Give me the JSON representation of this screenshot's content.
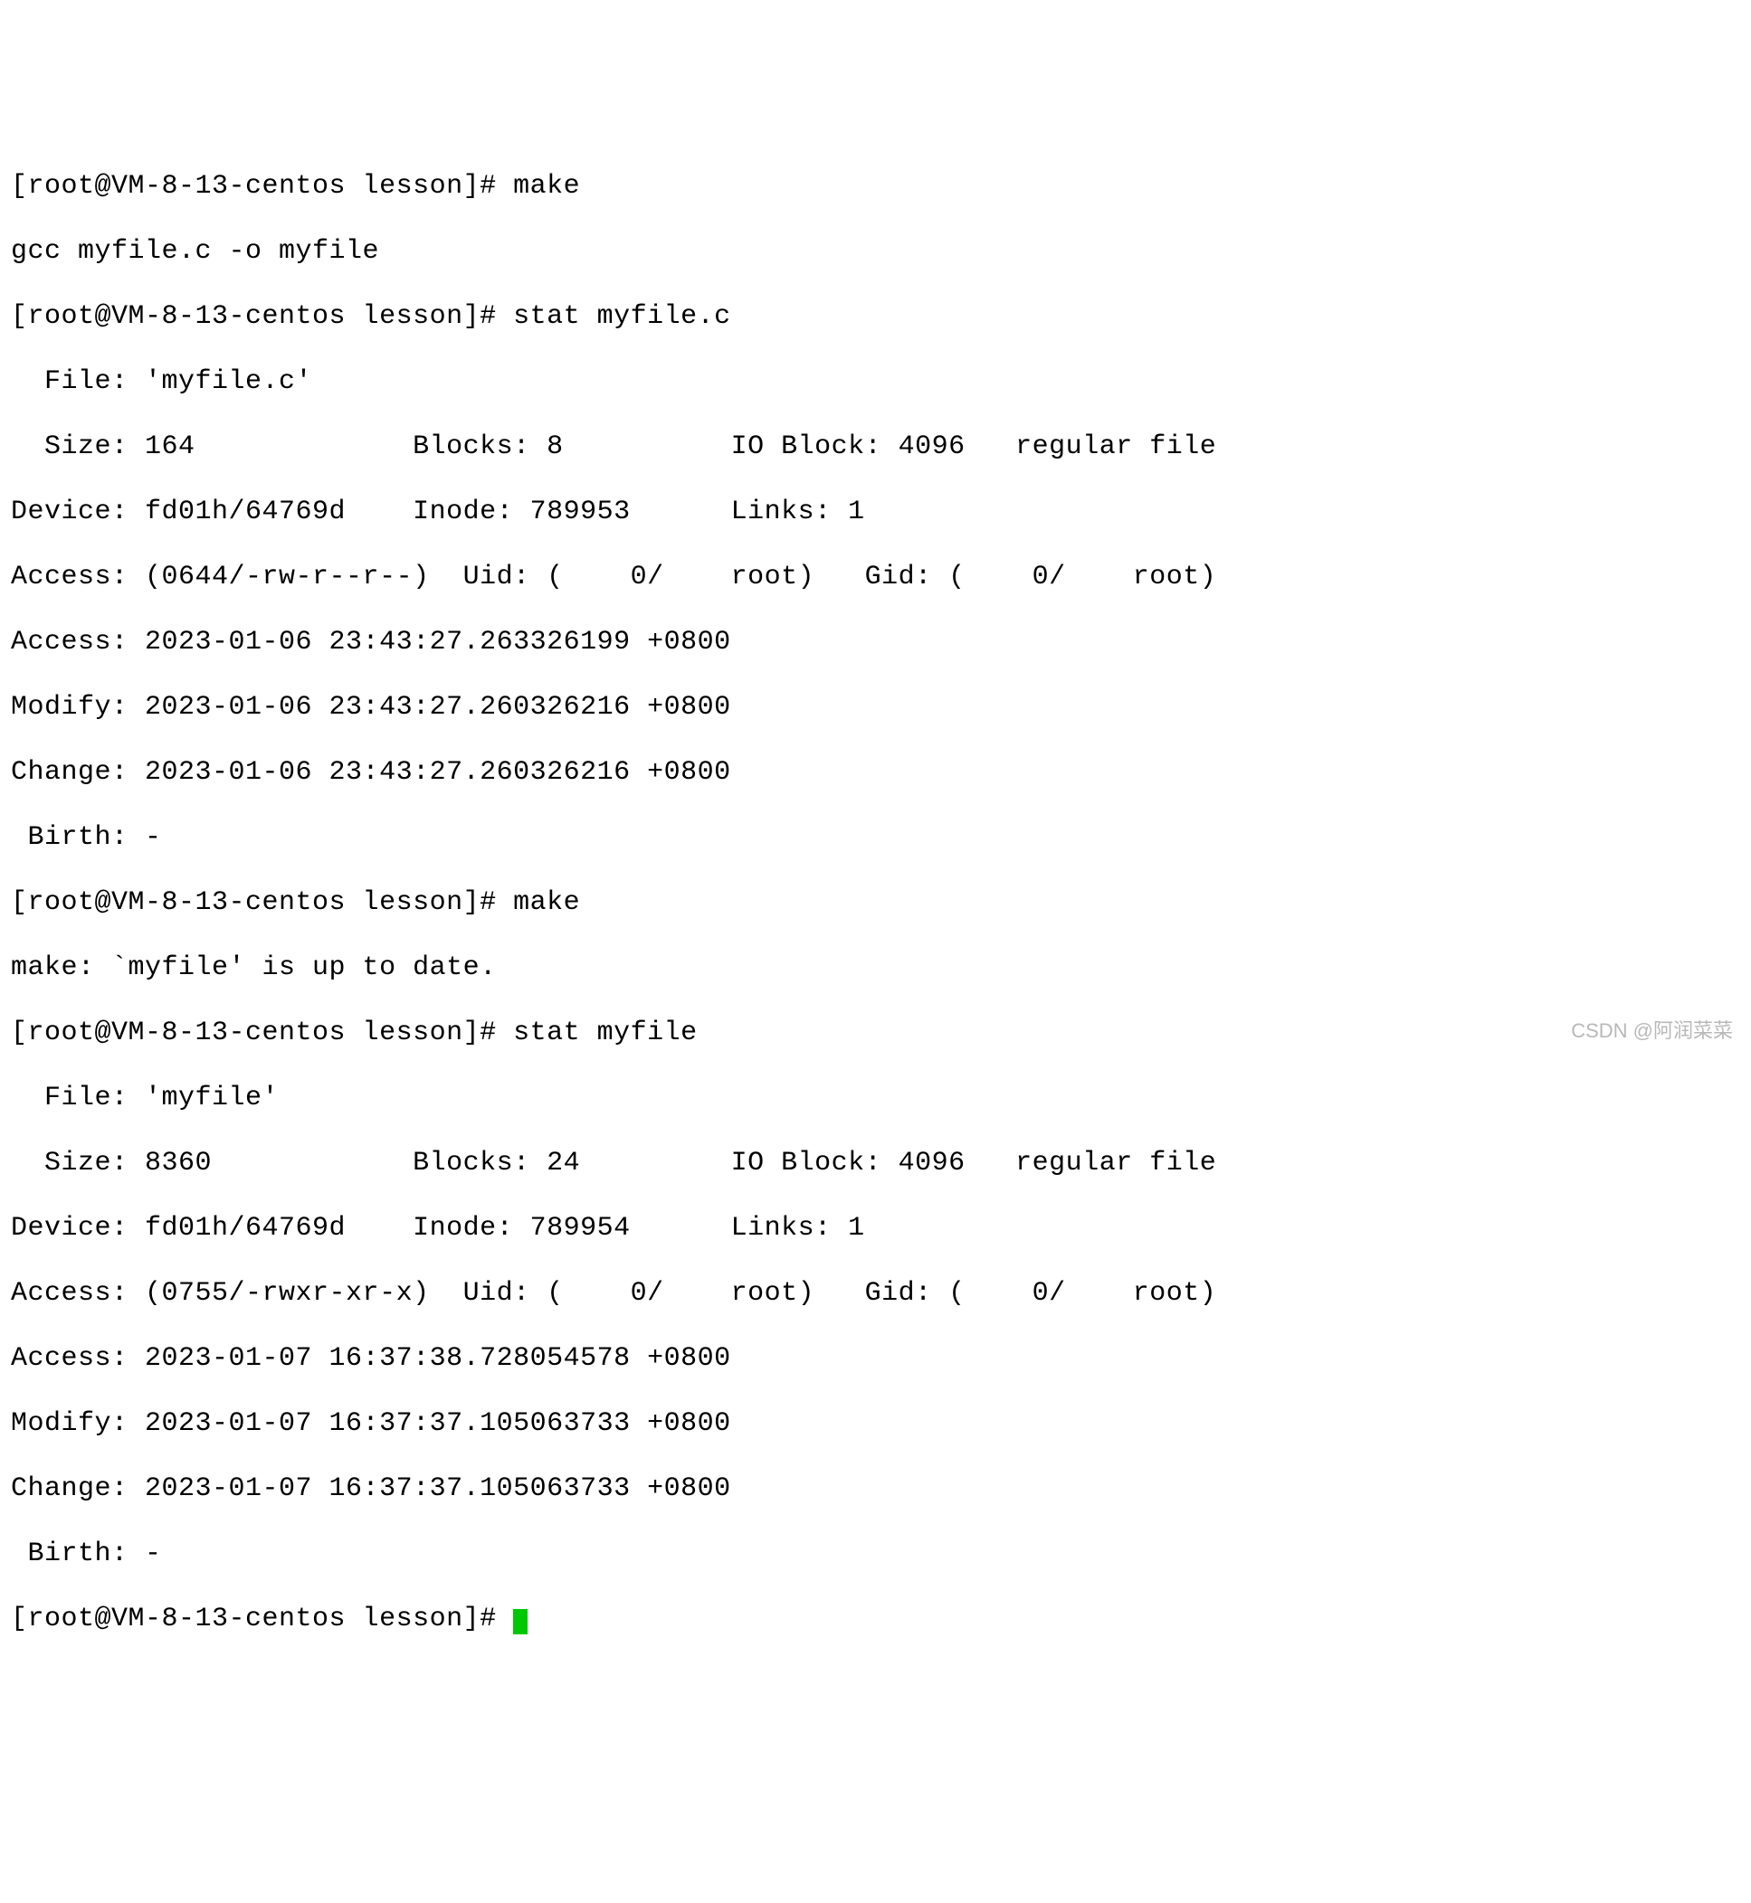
{
  "lines": {
    "l0": "[root@VM-8-13-centos lesson]# make",
    "l1": "gcc myfile.c -o myfile",
    "l2": "[root@VM-8-13-centos lesson]# stat myfile.c",
    "l3": "  File: 'myfile.c'",
    "l4": "  Size: 164             Blocks: 8          IO Block: 4096   regular file",
    "l5": "Device: fd01h/64769d    Inode: 789953      Links: 1",
    "l6": "Access: (0644/-rw-r--r--)  Uid: (    0/    root)   Gid: (    0/    root)",
    "l7": "Access: 2023-01-06 23:43:27.263326199 +0800",
    "l8": "Modify: 2023-01-06 23:43:27.260326216 +0800",
    "l9": "Change: 2023-01-06 23:43:27.260326216 +0800",
    "l10": " Birth: -",
    "l11": "[root@VM-8-13-centos lesson]# make",
    "l12": "make: `myfile' is up to date.",
    "l13": "[root@VM-8-13-centos lesson]# stat myfile",
    "l14": "  File: 'myfile'",
    "l15": "  Size: 8360            Blocks: 24         IO Block: 4096   regular file",
    "l16": "Device: fd01h/64769d    Inode: 789954      Links: 1",
    "l17": "Access: (0755/-rwxr-xr-x)  Uid: (    0/    root)   Gid: (    0/    root)",
    "l18": "Access: 2023-01-07 16:37:38.728054578 +0800",
    "l19": "Modify: 2023-01-07 16:37:37.105063733 +0800",
    "l20": "Change: 2023-01-07 16:37:37.105063733 +0800",
    "l21": " Birth: -",
    "l22": "[root@VM-8-13-centos lesson]# "
  },
  "watermark": "CSDN @阿润菜菜"
}
